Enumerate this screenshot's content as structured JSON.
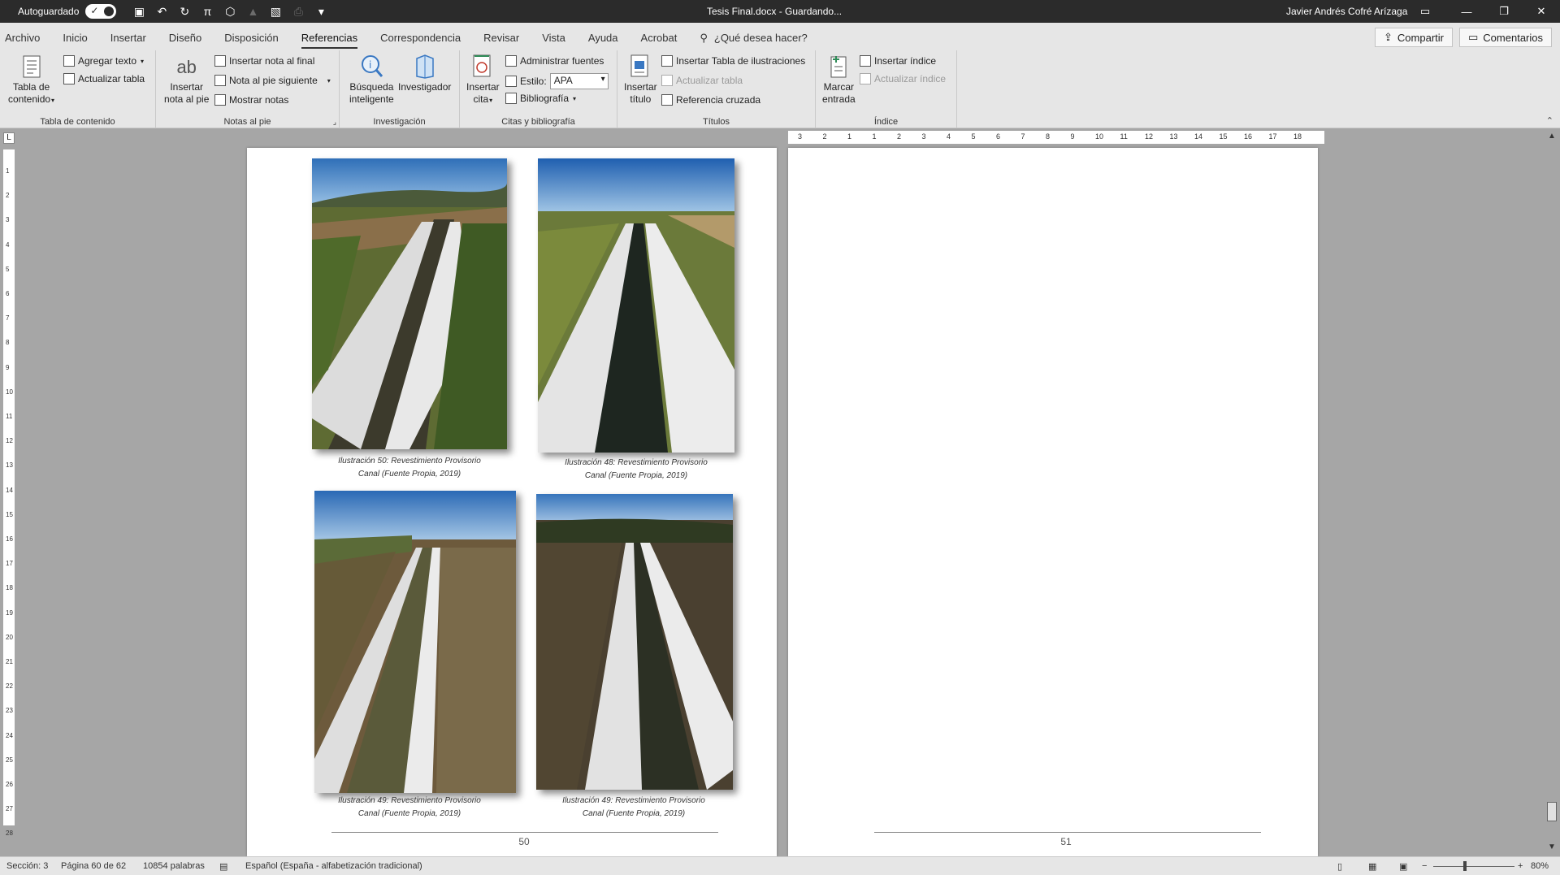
{
  "titlebar": {
    "autosave_label": "Autoguardado",
    "doc_title": "Tesis Final.docx  -  Guardando...",
    "user": "Javier Andrés Cofré Arízaga"
  },
  "menu": {
    "tabs": [
      "Archivo",
      "Inicio",
      "Insertar",
      "Diseño",
      "Disposición",
      "Referencias",
      "Correspondencia",
      "Revisar",
      "Vista",
      "Ayuda",
      "Acrobat"
    ],
    "active_tab": "Referencias",
    "search_placeholder": "¿Qué desea hacer?",
    "share": "Compartir",
    "comments": "Comentarios"
  },
  "ribbon": {
    "toc": {
      "label": "Tabla de contenido",
      "big_line1": "Tabla de",
      "big_line2": "contenido",
      "add_text": "Agregar texto",
      "update_table": "Actualizar tabla"
    },
    "footnotes": {
      "label": "Notas al pie",
      "big_line1": "Insertar",
      "big_line2": "nota al pie",
      "insert_endnote": "Insertar nota al final",
      "next_footnote": "Nota al pie siguiente",
      "show_notes": "Mostrar notas"
    },
    "research": {
      "label": "Investigación",
      "smart_line1": "Búsqueda",
      "smart_line2": "inteligente",
      "researcher": "Investigador"
    },
    "citations": {
      "label": "Citas y bibliografía",
      "big_line1": "Insertar",
      "big_line2": "cita",
      "manage_sources": "Administrar fuentes",
      "style_label": "Estilo:",
      "style_value": "APA",
      "bibliography": "Bibliografía"
    },
    "captions": {
      "label": "Títulos",
      "big_line1": "Insertar",
      "big_line2": "título",
      "insert_tof": "Insertar Tabla de ilustraciones",
      "update_table": "Actualizar tabla",
      "cross_ref": "Referencia cruzada"
    },
    "index": {
      "label": "Índice",
      "mark_line1": "Marcar",
      "mark_line2": "entrada",
      "insert_index": "Insertar índice",
      "update_index": "Actualizar índice"
    }
  },
  "document": {
    "left_page": {
      "page_number": "50",
      "captions": [
        {
          "line1": "Ilustración 50: Revestimiento Provisorio",
          "line2": "Canal (Fuente Propia, 2019)"
        },
        {
          "line1": "Ilustración 48: Revestimiento Provisorio",
          "line2": "Canal (Fuente Propia, 2019)"
        },
        {
          "line1": "Ilustración 49: Revestimiento Provisorio",
          "line2": "Canal (Fuente Propia, 2019)"
        },
        {
          "line1": "Ilustración 49: Revestimiento Provisorio",
          "line2": "Canal (Fuente Propia, 2019)"
        }
      ]
    },
    "right_page": {
      "page_number": "51"
    }
  },
  "ruler": {
    "h_marks": [
      "3",
      "2",
      "1",
      "1",
      "2",
      "3",
      "4",
      "5",
      "6",
      "7",
      "8",
      "9",
      "10",
      "11",
      "12",
      "13",
      "14",
      "15",
      "16",
      "17",
      "18"
    ],
    "v_marks": [
      "1",
      "2",
      "3",
      "4",
      "5",
      "6",
      "7",
      "8",
      "9",
      "10",
      "11",
      "12",
      "13",
      "14",
      "15",
      "16",
      "17",
      "18",
      "19",
      "20",
      "21",
      "22",
      "23",
      "24",
      "25",
      "26",
      "27",
      "28"
    ]
  },
  "status": {
    "section": "Sección: 3",
    "page": "Página 60 de 62",
    "words": "10854 palabras",
    "language": "Español (España - alfabetización tradicional)",
    "zoom": "80%"
  },
  "colors": {
    "titlebar": "#2b2b2b",
    "ribbon": "#e6e6e6",
    "workspace": "#a6a6a6"
  }
}
